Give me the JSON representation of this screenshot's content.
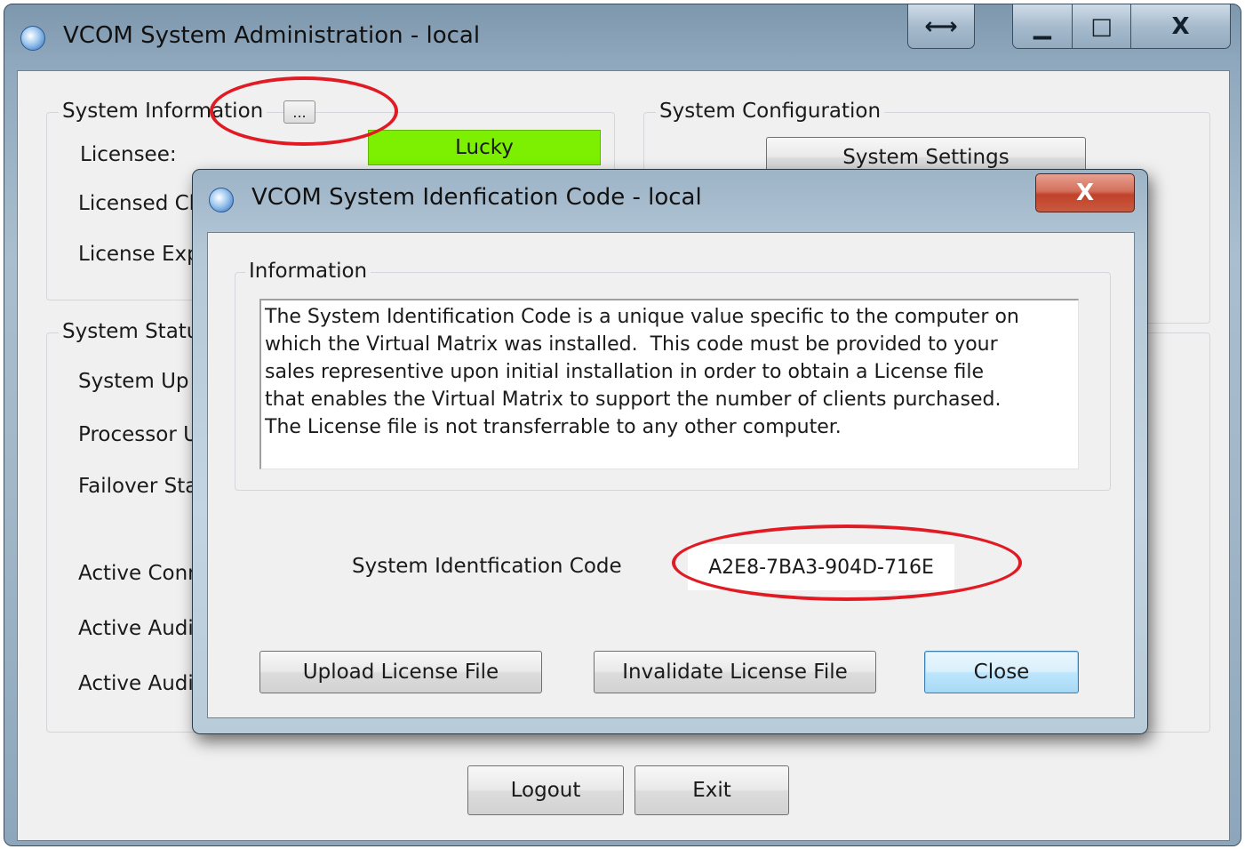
{
  "main_window": {
    "title": "VCOM System Administration - local",
    "caption_buttons": {
      "resize": "⟷",
      "minimize": "▁",
      "maximize": "□",
      "close": "X"
    },
    "system_information": {
      "group_title": "System Information",
      "ellipsis_button": "...",
      "licensee_label": "Licensee:",
      "licensee_value": "Lucky",
      "licensee_value_color": "#7cf000",
      "licensed_clients_label": "Licensed Cl",
      "license_expiry_label": "License Exp"
    },
    "system_configuration": {
      "group_title": "System Configuration",
      "system_settings_button": "System Settings"
    },
    "system_status": {
      "group_title": "System Statu",
      "system_uptime_label": "System Up T",
      "processor_label": "Processor U",
      "failover_label": "Failover Sta",
      "active_connections_label": "Active Conn",
      "active_audio_1_label": "Active Audi",
      "active_audio_2_label": "Active Audi"
    },
    "logout_button": "Logout",
    "exit_button": "Exit"
  },
  "dialog": {
    "title": "VCOM System Idenfication Code - local",
    "close_glyph": "X",
    "information": {
      "group_title": "Information",
      "text": "The System Identification Code is a unique value specific to the computer on\nwhich the Virtual Matrix was installed.  This code must be provided to your\nsales representive upon initial installation in order to obtain a License file\nthat enables the Virtual Matrix to support the number of clients purchased.\nThe License file is not transferrable to any other computer."
    },
    "sysid_label": "System Identfication Code",
    "sysid_value": "A2E8-7BA3-904D-716E",
    "upload_button": "Upload License File",
    "invalidate_button": "Invalidate License File",
    "close_button": "Close"
  },
  "annotation_color": "#e01b24"
}
